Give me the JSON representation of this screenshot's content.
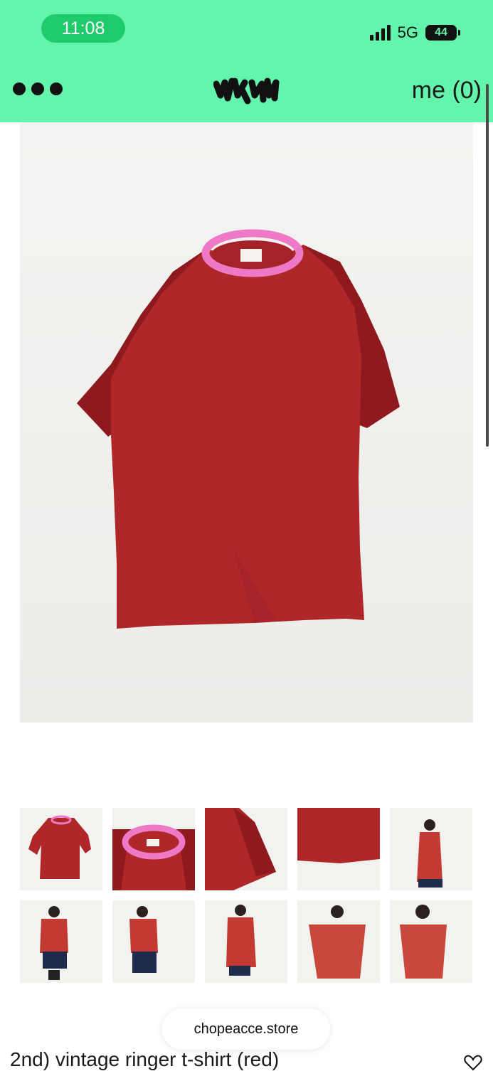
{
  "status_bar": {
    "time": "11:08",
    "network": "5G",
    "battery_level": "44",
    "signal_bars": 4
  },
  "header": {
    "logo_icon": "handwritten-logo",
    "menu_icon": "more-dots-icon",
    "me_label": "me (0)"
  },
  "gallery": {
    "main_image": "red ringer t-shirt with pink collar on white wall",
    "thumbnail_count": 10
  },
  "store": {
    "domain": "chopeacce.store"
  },
  "product": {
    "title": "2nd) vintage ringer t-shirt (red)"
  },
  "colors": {
    "accent": "#64f5ac",
    "time_pill": "#1fcc6c",
    "shirt_body": "#b0272a",
    "shirt_sleeve": "#8e1a1f",
    "collar": "#ee79c7"
  }
}
